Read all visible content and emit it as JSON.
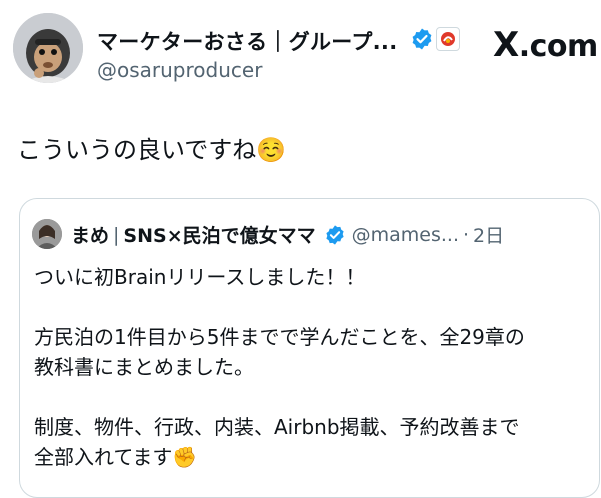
{
  "author": {
    "display_name": "マーケターおさる｜グループ...",
    "handle": "@osaruproducer",
    "verified_icon": "verified-badge-icon",
    "affiliation_icon": "affiliate-badge-icon"
  },
  "brand": {
    "logo": "X",
    "suffix": ".com"
  },
  "post": {
    "text": "こういうの良いですね",
    "emoji": "☺️"
  },
  "quoted": {
    "display_name": "まめ",
    "separator": "|",
    "name_rest": "SNS×民泊で億女ママ",
    "handle": "@mames...",
    "dot": "·",
    "time": "2日",
    "lines": {
      "l1": "ついに初Brainリリースしました！！",
      "l2": "方民泊の1件目から5件までで学んだことを、全29章の",
      "l3": "教科書にまとめました。",
      "l4": "制度、物件、行政、内装、Airbnb掲載、予約改善まで",
      "l5": "全部入れてます",
      "l5_emoji": "✊"
    }
  },
  "colors": {
    "text": "#0f1419",
    "secondary": "#536471",
    "border": "#cfd9de",
    "verified": "#1d9bf0"
  }
}
